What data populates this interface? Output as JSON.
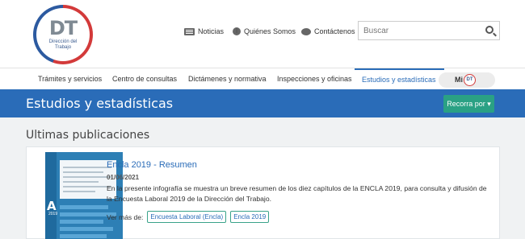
{
  "logo": {
    "initials": "DT",
    "subtitle_line1": "Dirección del",
    "subtitle_line2": "Trabajo"
  },
  "toplinks": [
    {
      "label": "Noticias",
      "icon": "newspaper-icon"
    },
    {
      "label": "Quiénes Somos",
      "icon": "info-icon"
    },
    {
      "label": "Contáctenos",
      "icon": "chat-icon"
    }
  ],
  "search": {
    "placeholder": "Buscar"
  },
  "nav": {
    "items": [
      {
        "label": "Trámites y servicios"
      },
      {
        "label": "Centro de consultas"
      },
      {
        "label": "Dictámenes y normativa"
      },
      {
        "label": "Inspecciones y oficinas"
      },
      {
        "label": "Estudios y estadísticas",
        "active": true
      }
    ],
    "midt": {
      "label": "Mi",
      "badge": "DT"
    }
  },
  "banner": {
    "title": "Estudios y estadísticas",
    "button": "Recorra por ▾"
  },
  "main": {
    "section_title": "Ultimas publicaciones",
    "publications": [
      {
        "title": "Encla 2019 - Resumen",
        "date": "01/06/2021",
        "description": "En la presente infografía se muestra un breve resumen de los diez capítulos de la ENCLA 2019, para consulta y difusión de la Encuesta Laboral 2019 de la Dirección del Trabajo.",
        "see_more_label": "Ver más de:",
        "tags": [
          "Encuesta Laboral (Encla)",
          "Encla 2019"
        ],
        "thumb": {
          "big_text": "A",
          "year_text": "2019"
        }
      }
    ]
  },
  "colors": {
    "brand_blue": "#2a6cb8",
    "accent_green": "#2aa184",
    "logo_red": "#d33a3a"
  }
}
